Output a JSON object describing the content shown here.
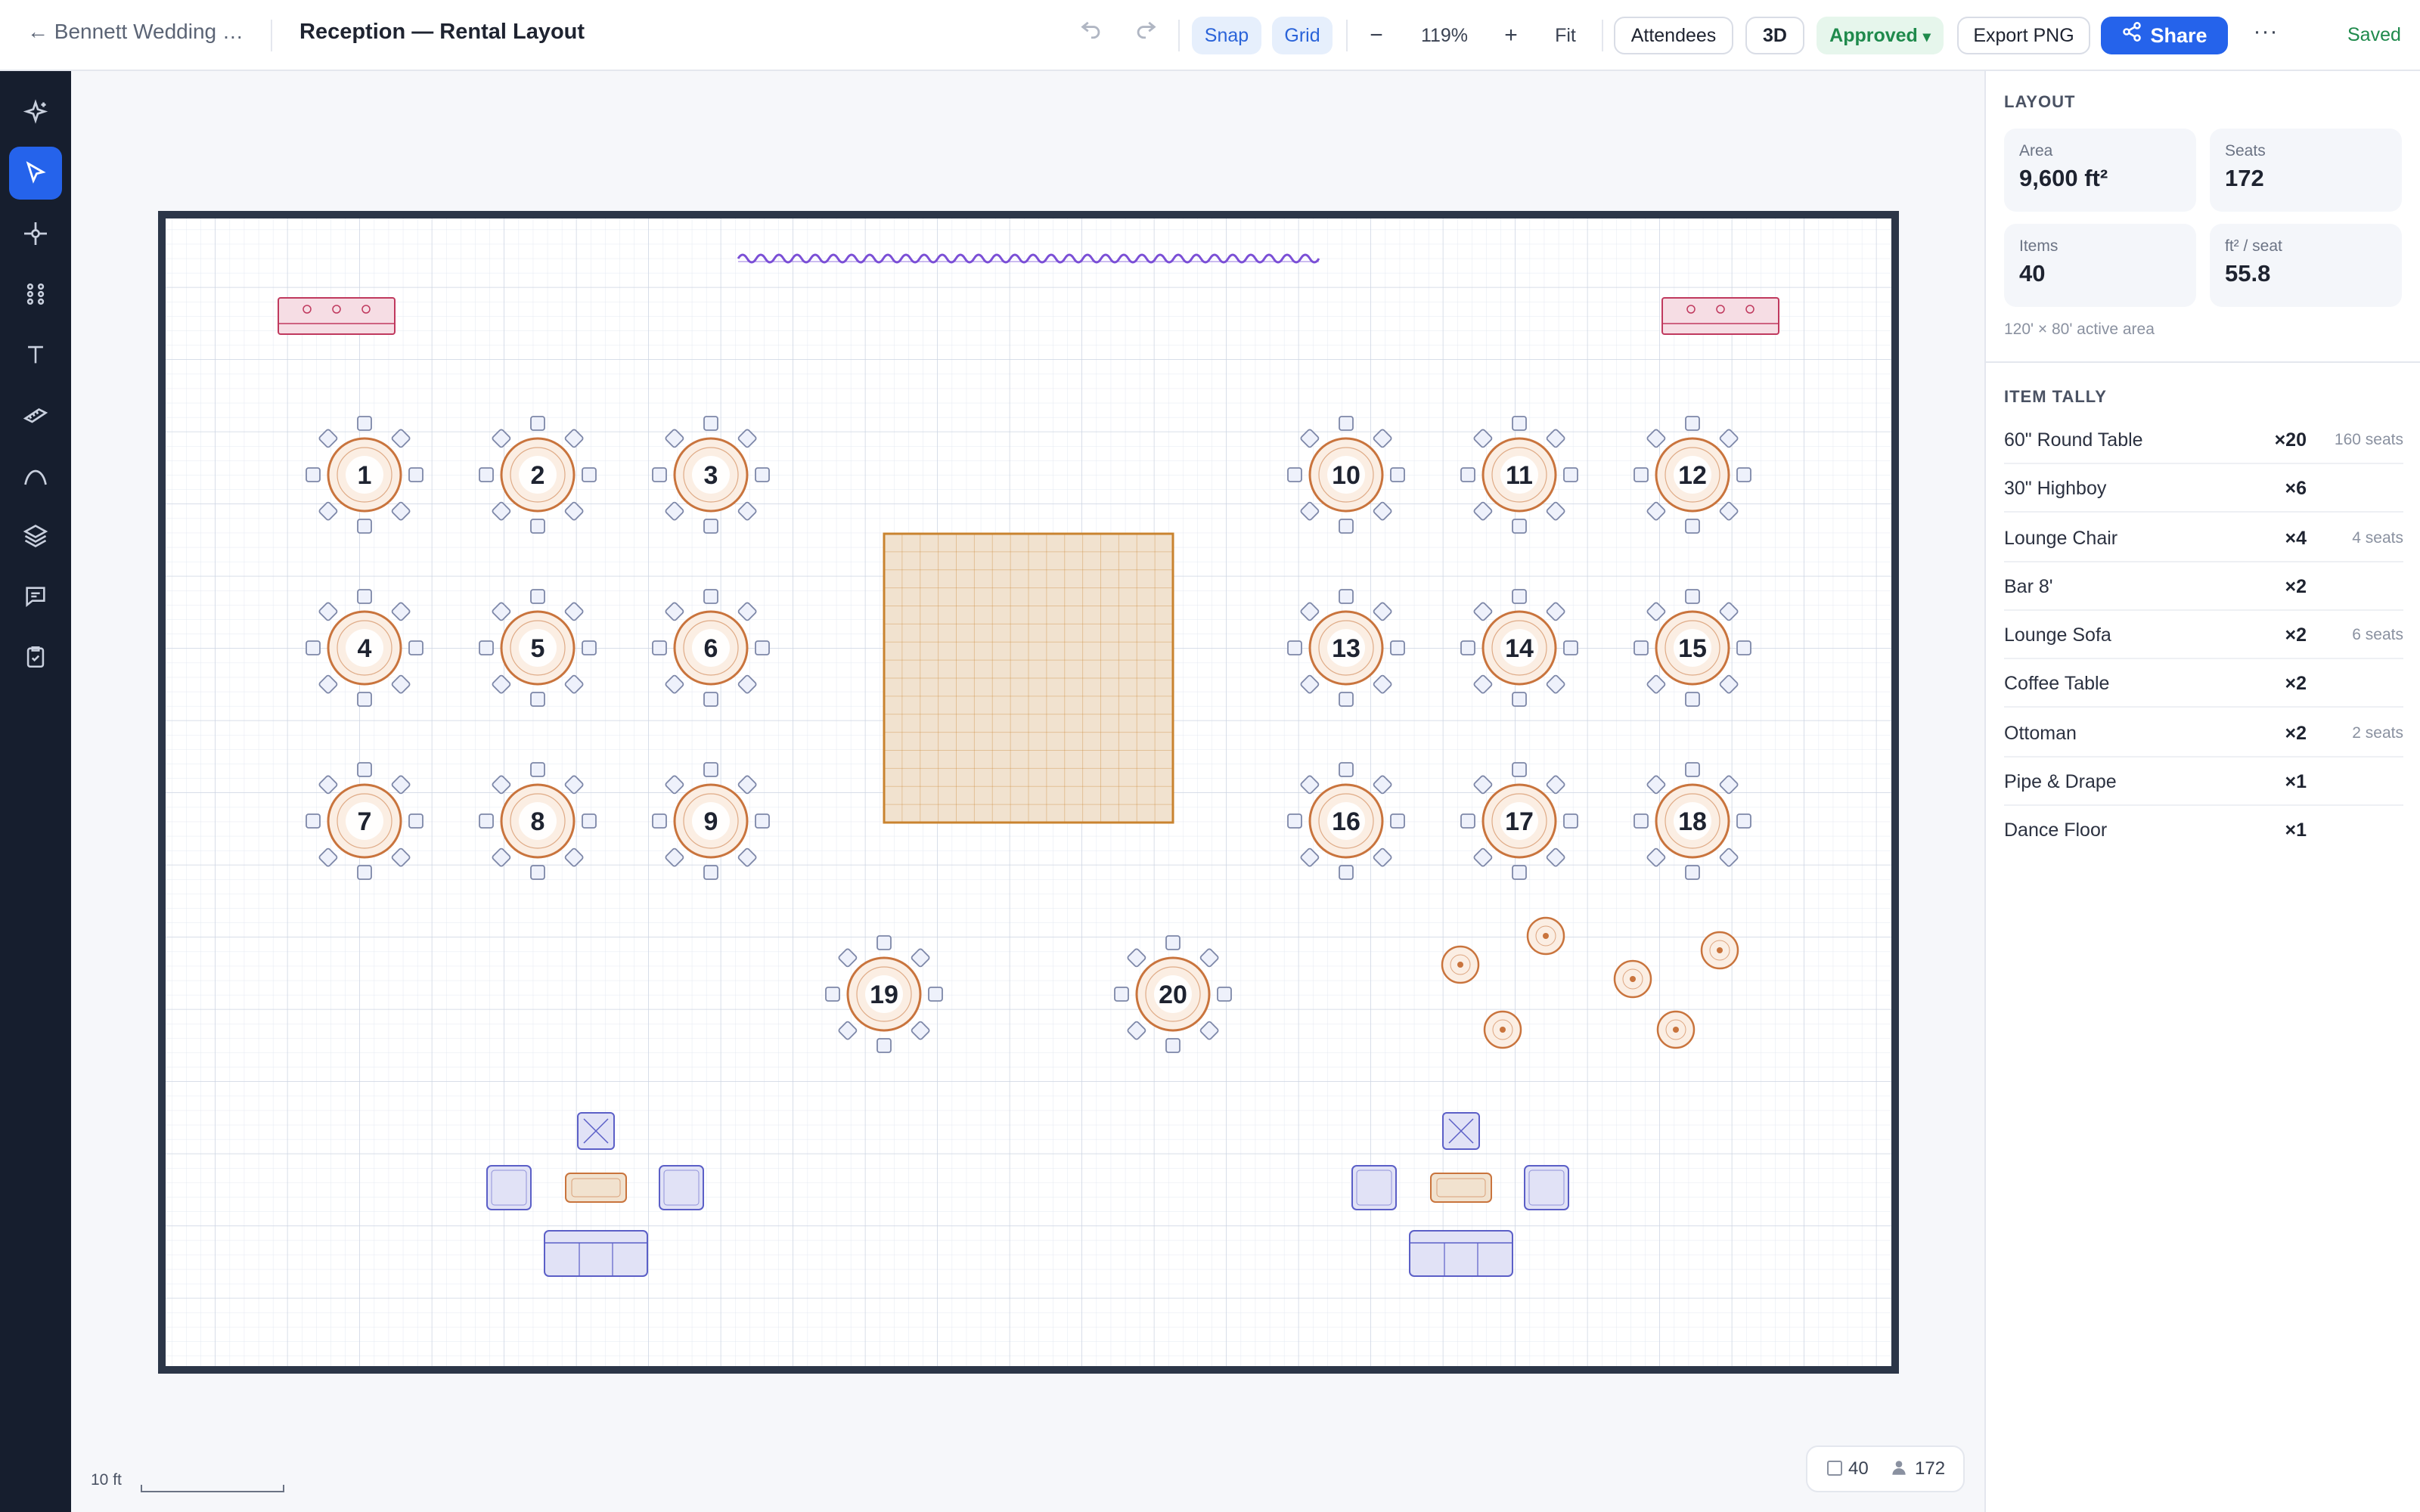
{
  "toolbar": {
    "back_label": "← Bennett Wedding …",
    "doc_title": "Reception — Rental Layout",
    "undo_icon": "undo-icon",
    "redo_icon": "redo-icon",
    "snap": "Snap",
    "grid": "Grid",
    "zoom_out": "−",
    "zoom_level": "119%",
    "zoom_in": "+",
    "fit": "Fit",
    "attendees": "Attendees",
    "three_d": "3D",
    "status": "Approved",
    "status_caret": "▾",
    "export": "Export PNG",
    "share": "Share",
    "more": "···",
    "saved": "Saved"
  },
  "sidebar": {
    "items": [
      {
        "name": "magic-icon",
        "active": false
      },
      {
        "name": "select-icon",
        "active": true
      },
      {
        "name": "node-icon",
        "active": false
      },
      {
        "name": "components-icon",
        "active": false
      },
      {
        "name": "text-icon",
        "active": false
      },
      {
        "name": "ruler-icon",
        "active": false
      },
      {
        "name": "curve-icon",
        "active": false
      },
      {
        "name": "layers-icon",
        "active": false
      },
      {
        "name": "comment-icon",
        "active": false
      },
      {
        "name": "checklist-icon",
        "active": false
      }
    ]
  },
  "floorplan": {
    "tables": [
      {
        "label": "1"
      },
      {
        "label": "2"
      },
      {
        "label": "3"
      },
      {
        "label": "4"
      },
      {
        "label": "5"
      },
      {
        "label": "6"
      },
      {
        "label": "7"
      },
      {
        "label": "8"
      },
      {
        "label": "9"
      },
      {
        "label": "10"
      },
      {
        "label": "11"
      },
      {
        "label": "12"
      },
      {
        "label": "13"
      },
      {
        "label": "14"
      },
      {
        "label": "15"
      },
      {
        "label": "16"
      },
      {
        "label": "17"
      },
      {
        "label": "18"
      },
      {
        "label": "19"
      },
      {
        "label": "20"
      }
    ],
    "colors": {
      "table_fill": "#fbeee3",
      "table_stroke": "#c9743d",
      "chair_fill": "#eef1fb",
      "chair_stroke": "#7d87a8",
      "bar_fill": "#f6dde4",
      "bar_stroke": "#c0395e",
      "lounge_fill": "#e1e2f6",
      "lounge_stroke": "#5b5fc7",
      "dance_fill": "#f1e2cf",
      "dance_stroke": "#c9832f",
      "drape": "#7b4fd6",
      "wall": "#2c3648"
    }
  },
  "scale": {
    "label": "10 ft"
  },
  "footer_counts": {
    "items": "40",
    "seats": "172"
  },
  "panel": {
    "layout_title": "LAYOUT",
    "stats": [
      {
        "label": "Area",
        "value": "9,600 ft²"
      },
      {
        "label": "Seats",
        "value": "172"
      },
      {
        "label": "Items",
        "value": "40"
      },
      {
        "label": "ft² / seat",
        "value": "55.8"
      }
    ],
    "active_area": "120' × 80' active area",
    "tally_title": "ITEM TALLY",
    "tally": [
      {
        "name": "60\" Round Table",
        "count": "×20",
        "seats": "160 seats"
      },
      {
        "name": "30\" Highboy",
        "count": "×6",
        "seats": ""
      },
      {
        "name": "Lounge Chair",
        "count": "×4",
        "seats": "4 seats"
      },
      {
        "name": "Bar 8'",
        "count": "×2",
        "seats": ""
      },
      {
        "name": "Lounge Sofa",
        "count": "×2",
        "seats": "6 seats"
      },
      {
        "name": "Coffee Table",
        "count": "×2",
        "seats": ""
      },
      {
        "name": "Ottoman",
        "count": "×2",
        "seats": "2 seats"
      },
      {
        "name": "Pipe & Drape",
        "count": "×1",
        "seats": ""
      },
      {
        "name": "Dance Floor",
        "count": "×1",
        "seats": ""
      }
    ]
  }
}
